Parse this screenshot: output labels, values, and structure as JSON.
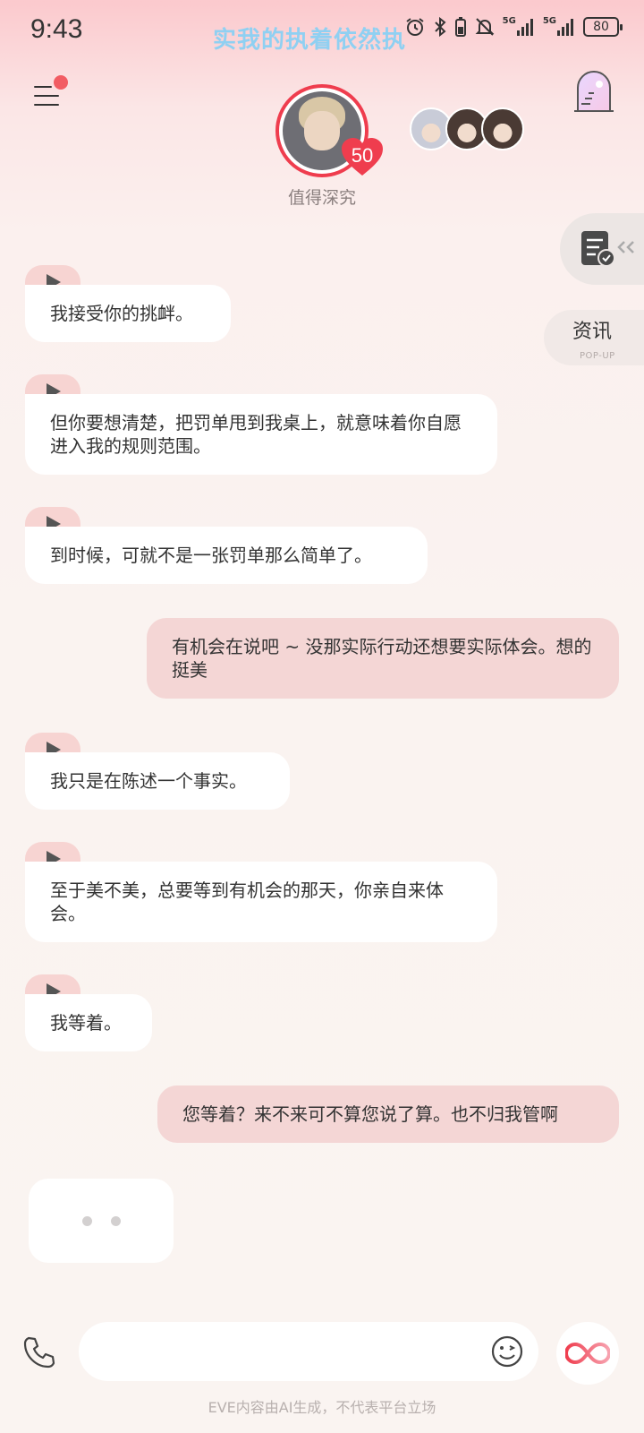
{
  "status_bar": {
    "time": "9:43",
    "ticker": "实我的执着依然执",
    "battery": "80",
    "network_1": "5G",
    "network_2": "5G",
    "icons": [
      "alarm-icon",
      "bluetooth-icon",
      "battery-saver-icon",
      "mute-icon",
      "signal-icon",
      "signal-icon",
      "battery-icon"
    ]
  },
  "header": {
    "character_caption": "值得深究",
    "affinity": "50",
    "menu_icon": "menu-icon",
    "room_icon": "room-door-icon"
  },
  "side_panel": {
    "task_icon": "checklist-icon",
    "news_label": "资讯",
    "news_sub": "POP-UP"
  },
  "messages": [
    {
      "role": "ai",
      "text": "我接受你的挑衅。"
    },
    {
      "role": "ai",
      "text": "但你要想清楚，把罚单甩到我桌上，就意味着你自愿进入我的规则范围。"
    },
    {
      "role": "ai",
      "text": "到时候，可就不是一张罚单那么简单了。"
    },
    {
      "role": "user",
      "text": "有机会在说吧 ~ 没那实际行动还想要实际体会。想的挺美"
    },
    {
      "role": "ai",
      "text": "我只是在陈述一个事实。"
    },
    {
      "role": "ai",
      "text": "至于美不美，总要等到有机会的那天，你亲自来体会。"
    },
    {
      "role": "ai",
      "text": "我等着。"
    },
    {
      "role": "user",
      "text": "您等着？来不来可不算您说了算。也不归我管啊"
    }
  ],
  "input": {
    "value": "",
    "placeholder": ""
  },
  "footer": {
    "disclaimer": "EVE内容由AI生成，不代表平台立场"
  },
  "colors": {
    "accent": "#ef3d4e",
    "user_bubble": "#f4d6d5",
    "ai_bubble": "#ffffff",
    "play_tab": "#f7d4d2"
  }
}
